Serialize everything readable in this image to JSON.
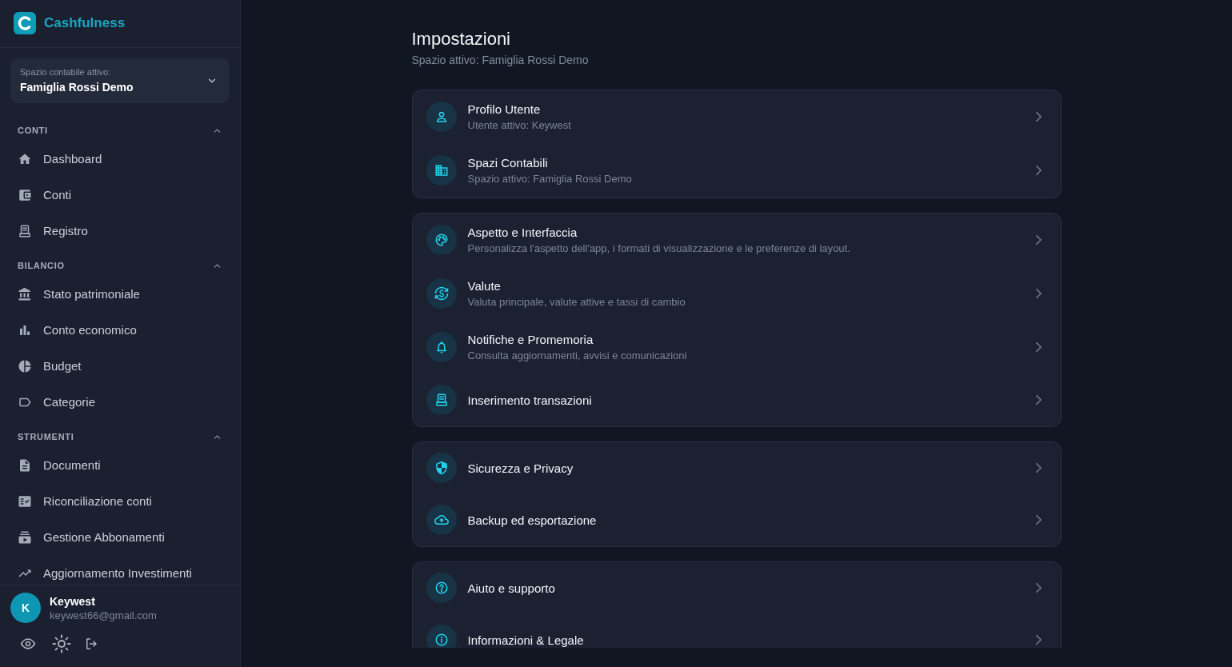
{
  "app": {
    "name": "Cashfulness"
  },
  "space_selector": {
    "label": "Spazio contabile attivo:",
    "value": "Famiglia Rossi Demo"
  },
  "nav_sections": [
    {
      "title": "CONTI",
      "expanded": true,
      "items": [
        {
          "label": "Dashboard"
        },
        {
          "label": "Conti"
        },
        {
          "label": "Registro"
        }
      ]
    },
    {
      "title": "BILANCIO",
      "expanded": true,
      "items": [
        {
          "label": "Stato patrimoniale"
        },
        {
          "label": "Conto economico"
        },
        {
          "label": "Budget"
        },
        {
          "label": "Categorie"
        }
      ]
    },
    {
      "title": "STRUMENTI",
      "expanded": true,
      "items": [
        {
          "label": "Documenti"
        },
        {
          "label": "Riconciliazione conti"
        },
        {
          "label": "Gestione Abbonamenti"
        },
        {
          "label": "Aggiornamento Investimenti"
        }
      ]
    }
  ],
  "user": {
    "initial": "K",
    "name": "Keywest",
    "email": "keywest66@gmail.com"
  },
  "page": {
    "title": "Impostazioni",
    "subtitle": "Spazio attivo: Famiglia Rossi Demo"
  },
  "settings_groups": [
    {
      "items": [
        {
          "title": "Profilo Utente",
          "subtitle": "Utente attivo: Keywest"
        },
        {
          "title": "Spazi Contabili",
          "subtitle": "Spazio attivo: Famiglia Rossi Demo"
        }
      ]
    },
    {
      "items": [
        {
          "title": "Aspetto e Interfaccia",
          "subtitle": "Personalizza l'aspetto dell'app, i formati di visualizzazione e le preferenze di layout."
        },
        {
          "title": "Valute",
          "subtitle": "Valuta principale, valute attive e tassi di cambio"
        },
        {
          "title": "Notifiche e Promemoria",
          "subtitle": "Consulta aggiornamenti, avvisi e comunicazioni"
        },
        {
          "title": "Inserimento transazioni"
        }
      ]
    },
    {
      "items": [
        {
          "title": "Sicurezza e Privacy"
        },
        {
          "title": "Backup ed esportazione"
        }
      ]
    },
    {
      "items": [
        {
          "title": "Aiuto e supporto"
        },
        {
          "title": "Informazioni & Legale"
        }
      ]
    }
  ]
}
